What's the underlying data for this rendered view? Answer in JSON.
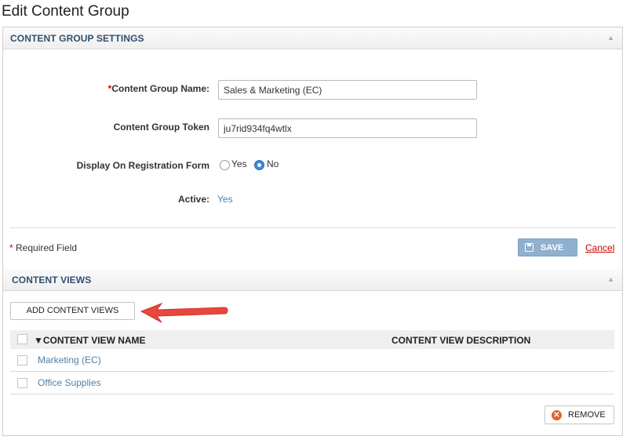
{
  "page": {
    "title": "Edit Content Group"
  },
  "settings": {
    "header": "CONTENT GROUP SETTINGS",
    "collapse_icon": "triangle-up-icon",
    "name_required_mark": "*",
    "name_label": "Content Group Name:",
    "name_value": "Sales & Marketing (EC)",
    "token_label": "Content Group Token",
    "token_value": "ju7rid934fq4wtlx",
    "display_label": "Display On Registration Form",
    "display_options": [
      {
        "label": "Yes",
        "selected": false
      },
      {
        "label": "No",
        "selected": true
      }
    ],
    "active_label": "Active:",
    "active_value": "Yes",
    "required_star": "*",
    "required_note": " Required Field",
    "save_label": "SAVE",
    "cancel_label": "Cancel"
  },
  "content_views": {
    "header": "CONTENT VIEWS",
    "collapse_icon": "triangle-up-icon",
    "add_button_label": "ADD CONTENT VIEWS",
    "columns": [
      {
        "label": "CONTENT VIEW NAME",
        "sort_indicator": "▼"
      },
      {
        "label": "CONTENT VIEW DESCRIPTION"
      }
    ],
    "rows": [
      {
        "name": "Marketing (EC)",
        "description": ""
      },
      {
        "name": "Office Supplies",
        "description": ""
      }
    ],
    "remove_button_label": "REMOVE"
  },
  "annotation": {
    "arrow_color": "#e8473c"
  },
  "colors": {
    "accent_link": "#4d7fa8",
    "save_button": "#8fb0cf",
    "required": "#cc0000",
    "radio_selected": "#3b86d6"
  }
}
